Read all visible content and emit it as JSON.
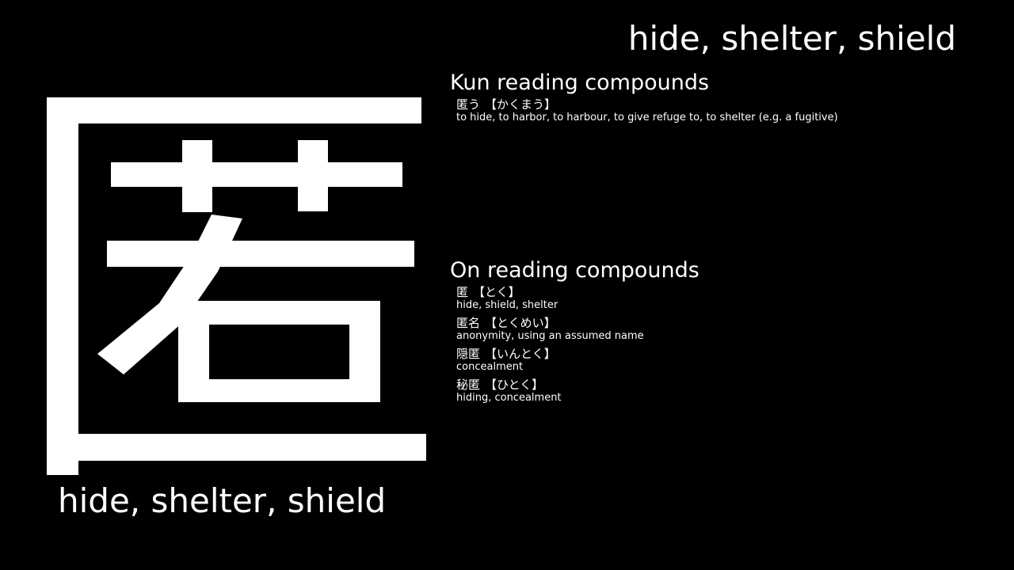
{
  "kanji": {
    "character": "匿",
    "meaning_top": "hide, shelter, shield",
    "meaning_bottom": "hide, shelter, shield"
  },
  "kun_section": {
    "title": "Kun reading compounds",
    "compounds": [
      {
        "word": "匿う",
        "reading": "【かくまう】",
        "gloss": "to hide, to harbor, to harbour, to give refuge to, to shelter (e.g. a fugitive)"
      }
    ]
  },
  "on_section": {
    "title": "On reading compounds",
    "compounds": [
      {
        "word": "匿",
        "reading": "【とく】",
        "gloss": "hide, shield, shelter"
      },
      {
        "word": "匿名",
        "reading": "【とくめい】",
        "gloss": "anonymity, using an assumed name"
      },
      {
        "word": "隠匿",
        "reading": "【いんとく】",
        "gloss": "concealment"
      },
      {
        "word": "秘匿",
        "reading": "【ひとく】",
        "gloss": "hiding, concealment"
      }
    ]
  },
  "colors": {
    "background": "#000000",
    "foreground": "#ffffff"
  }
}
